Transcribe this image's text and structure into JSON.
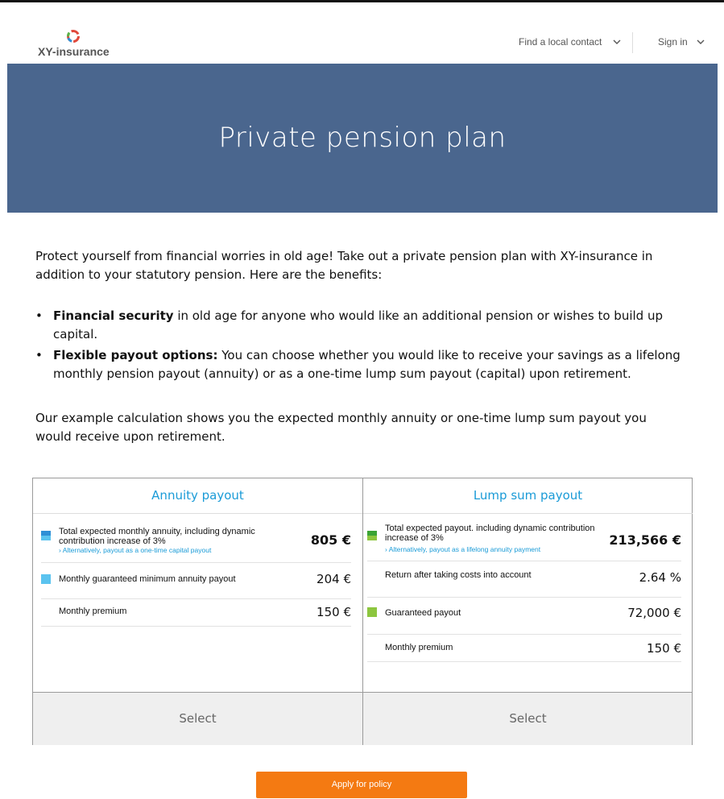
{
  "header": {
    "logo_text": "XY-insurance",
    "find_contact": "Find a local contact",
    "sign_in": "Sign in",
    "chevron": "⌄"
  },
  "hero": {
    "title": "Private pension plan"
  },
  "intro": "Protect yourself from financial worries in old age! Take out a private pension plan with XY-insurance in addition to your statutory pension. Here are the benefits:",
  "bullets": [
    {
      "bold": "Financial security",
      "text": " in old age for anyone who would like an additional pension or wishes to build up capital."
    },
    {
      "bold": "Flexible payout options:",
      "text": " You can choose whether you would like to receive your savings as a lifelong monthly pension payout (annuity) or as a one-time lump sum payout (capital) upon retirement."
    }
  ],
  "outro": "Our example calculation shows you the expected monthly annuity or one-time lump sum payout you would receive upon retirement.",
  "annuity": {
    "title": "Annuity payout",
    "rows": [
      {
        "label": "Total expected monthly annuity, including dynamic contribution increase of 3%",
        "sub": "›  Alternatively, payout as a one-time capital payout",
        "value": "805 €"
      },
      {
        "label": "Monthly guaranteed minimum annuity payout",
        "value": "204 €"
      },
      {
        "label": "Monthly premium",
        "value": "150 €"
      }
    ],
    "select": "Select"
  },
  "lump_sum": {
    "title": "Lump sum payout",
    "rows": [
      {
        "label": "Total expected payout. including dynamic contribution increase of 3%",
        "sub": "›  Alternatively, payout as a lifelong annuity payment",
        "value": "213,566 €"
      },
      {
        "label": "Return after taking costs into account",
        "value": "2.64 %"
      },
      {
        "label": "Guaranteed payout",
        "value": "72,000 €"
      },
      {
        "label": "Monthly premium",
        "value": "150 €"
      }
    ],
    "select": "Select"
  },
  "apply_button": "Apply for policy",
  "colors": {
    "hero": "#4a668e",
    "accent_blue": "#1a9bd7",
    "swatch_blue_dark": "#2f8fd6",
    "swatch_blue_light": "#5bc3ef",
    "swatch_green_dark": "#3aa335",
    "swatch_green": "#8dc63f",
    "apply_orange": "#f47a12"
  }
}
